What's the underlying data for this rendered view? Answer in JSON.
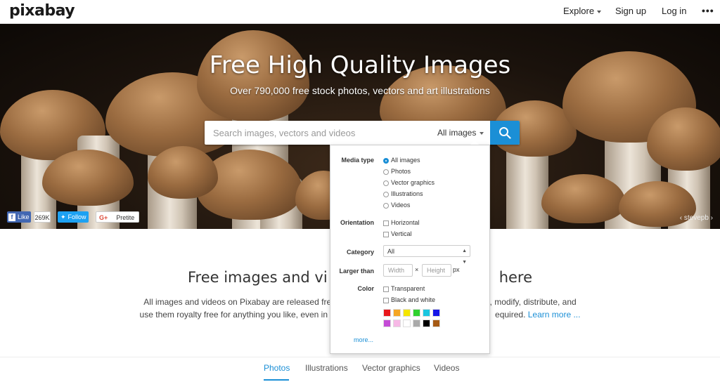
{
  "header": {
    "logo": "pixabay",
    "explore": "Explore",
    "signup": "Sign up",
    "login": "Log in",
    "more": "•••"
  },
  "hero": {
    "title": "Free High Quality Images",
    "subtitle": "Over 790,000 free stock photos, vectors and art illustrations",
    "search_placeholder": "Search images, vectors and videos",
    "media_selected": "All images",
    "social": {
      "fb_like": "Like",
      "fb_count": "269K",
      "tw_follow": "Follow",
      "gp_share": "Pretite"
    },
    "credit": "stevepb"
  },
  "panel": {
    "media_type_label": "Media type",
    "media_types": [
      "All images",
      "Photos",
      "Vector graphics",
      "Illustrations",
      "Videos"
    ],
    "orientation_label": "Orientation",
    "orientations": [
      "Horizontal",
      "Vertical"
    ],
    "category_label": "Category",
    "category_value": "All",
    "larger_than_label": "Larger than",
    "width_placeholder": "Width",
    "height_placeholder": "Height",
    "times": "×",
    "px": "px",
    "color_label": "Color",
    "color_options": [
      "Transparent",
      "Black and white"
    ],
    "swatches_row1": [
      "#e8171b",
      "#f5a623",
      "#f5e600",
      "#2fd12f",
      "#1bc6e0",
      "#1515e8"
    ],
    "swatches_row2": [
      "#c44bd6",
      "#f7b8e6",
      "#ffffff",
      "#aaaaaa",
      "#000000",
      "#a65a14"
    ],
    "more": "more..."
  },
  "section": {
    "title_left": "Free images and vi",
    "title_right": "here",
    "text_line1_left": "All images and videos on Pixabay are released free of copyrig",
    "text_line1_right": "download, modify, distribute, and",
    "text_line2_left": "use them royalty free for anything you like, even in",
    "text_line2_right": "equired.",
    "learn_more": "Learn more ..."
  },
  "tabs": [
    "Photos",
    "Illustrations",
    "Vector graphics",
    "Videos"
  ]
}
